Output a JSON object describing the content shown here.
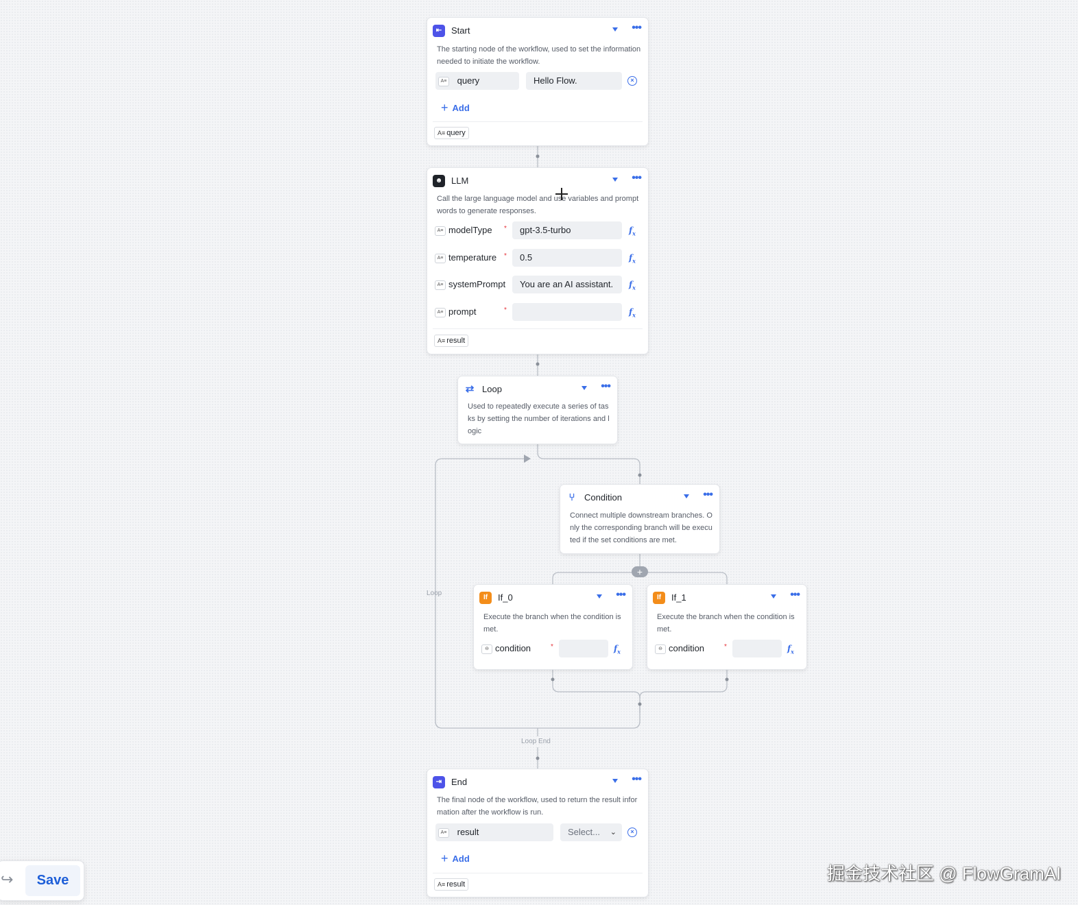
{
  "start": {
    "title": "Start",
    "description": "The starting node of the workflow, used to set the information needed to initiate the workflow.",
    "param_name": "query",
    "param_value": "Hello Flow.",
    "add_label": "Add",
    "output": "query",
    "type_tag": "A≡"
  },
  "llm": {
    "title": "LLM",
    "description": "Call the large language model and use variables and prompt words to generate responses.",
    "params": [
      {
        "name": "modelType",
        "value": "gpt-3.5-turbo",
        "required": "*"
      },
      {
        "name": "temperature",
        "value": "0.5",
        "required": "*"
      },
      {
        "name": "systemPrompt",
        "value": "You are an AI assistant.",
        "required": ""
      },
      {
        "name": "prompt",
        "value": "",
        "required": "*"
      }
    ],
    "output": "result"
  },
  "loop": {
    "title": "Loop",
    "description": "Used to repeatedly execute a series of tasks by setting the number of iterations and logic",
    "label": "Loop",
    "end_label": "Loop End"
  },
  "condition": {
    "title": "Condition",
    "description": "Connect multiple downstream branches. Only the corresponding branch will be executed if the set conditions are met."
  },
  "if0": {
    "title": "If_0",
    "description": "Execute the branch when the condition is met.",
    "param_name": "condition",
    "required": "*"
  },
  "if1": {
    "title": "If_1",
    "description": "Execute the branch when the condition is met.",
    "param_name": "condition",
    "required": "*"
  },
  "end": {
    "title": "End",
    "description": "The final node of the workflow, used to return the result information after the workflow is run.",
    "param_name": "result",
    "select_placeholder": "Select...",
    "add_label": "Add",
    "output": "result"
  },
  "toolbar": {
    "save_label": "Save"
  },
  "watermark": "掘金技术社区 @ FlowGramAI",
  "colors": {
    "accent": "#3a6ee8",
    "start_icon": "#4d53e8",
    "llm_icon": "#1f2329",
    "if_icon": "#f38d1a",
    "required": "#e6353c"
  }
}
